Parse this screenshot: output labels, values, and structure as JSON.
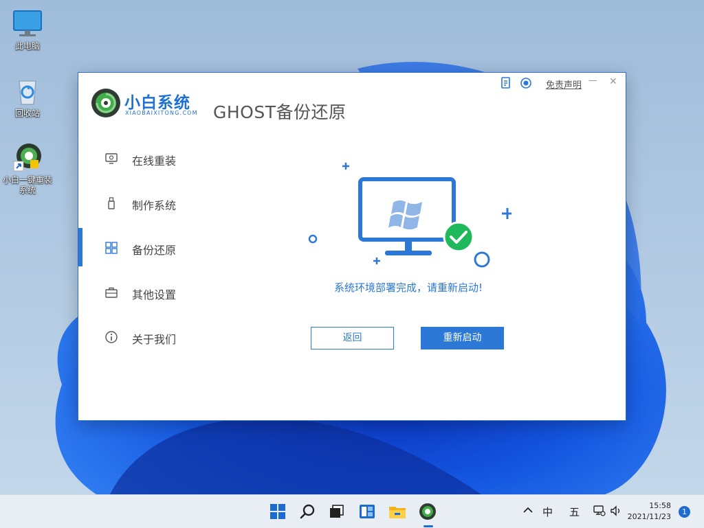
{
  "desktop": {
    "icons": [
      {
        "label": "此电脑"
      },
      {
        "label": "回收站"
      },
      {
        "label": "小白一键重装系统"
      }
    ]
  },
  "app": {
    "brand_name": "小白系统",
    "brand_sub": "XIAOBAIXITONG.COM",
    "title": "GHOST备份还原",
    "disclaimer": "免责声明",
    "minimize_glyph": "—",
    "close_glyph": "✕",
    "nav": [
      {
        "label": "在线重装",
        "icon": "monitor-icon"
      },
      {
        "label": "制作系统",
        "icon": "usb-drive-icon"
      },
      {
        "label": "备份还原",
        "icon": "grid-icon",
        "active": true
      },
      {
        "label": "其他设置",
        "icon": "briefcase-icon"
      },
      {
        "label": "关于我们",
        "icon": "info-icon"
      }
    ],
    "status": "系统环境部署完成，请重新启动!",
    "back_label": "返回",
    "restart_label": "重新启动",
    "accent": "#2c78d6",
    "success": "#1fb85a"
  },
  "taskbar": {
    "tray_ime": "中",
    "tray_day": "五",
    "time": "15:58",
    "date": "2021/11/23",
    "notifications": "1"
  }
}
